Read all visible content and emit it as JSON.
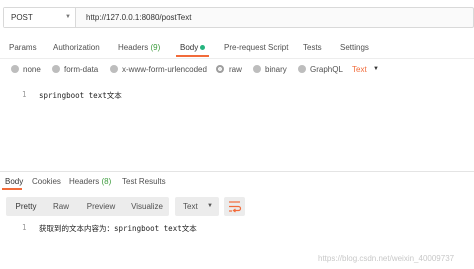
{
  "request": {
    "method": "POST",
    "url": "http://127.0.0.1:8080/postText"
  },
  "request_tabs": {
    "params": "Params",
    "authorization": "Authorization",
    "headers": "Headers",
    "headers_count": "(9)",
    "body": "Body",
    "prerequest": "Pre-request Script",
    "tests": "Tests",
    "settings": "Settings"
  },
  "body_types": {
    "none": "none",
    "form_data": "form-data",
    "urlencoded": "x-www-form-urlencoded",
    "raw": "raw",
    "binary": "binary",
    "graphql": "GraphQL",
    "raw_format": "Text",
    "selected": "raw"
  },
  "editor": {
    "line_number": "1",
    "text": "springboot text文本"
  },
  "response_tabs": {
    "body": "Body",
    "cookies": "Cookies",
    "headers": "Headers",
    "headers_count": "(8)",
    "test_results": "Test Results"
  },
  "response_toolbar": {
    "pretty": "Pretty",
    "raw": "Raw",
    "preview": "Preview",
    "visualize": "Visualize",
    "format": "Text",
    "active": "Pretty"
  },
  "response": {
    "line_number": "1",
    "text": "获取到的文本内容为：springboot text文本"
  },
  "watermark": "https://blog.csdn.net/weixin_40009737",
  "colors": {
    "accent": "#f26b3a",
    "active_dot": "#26b47f",
    "count": "#3c9b3c"
  }
}
